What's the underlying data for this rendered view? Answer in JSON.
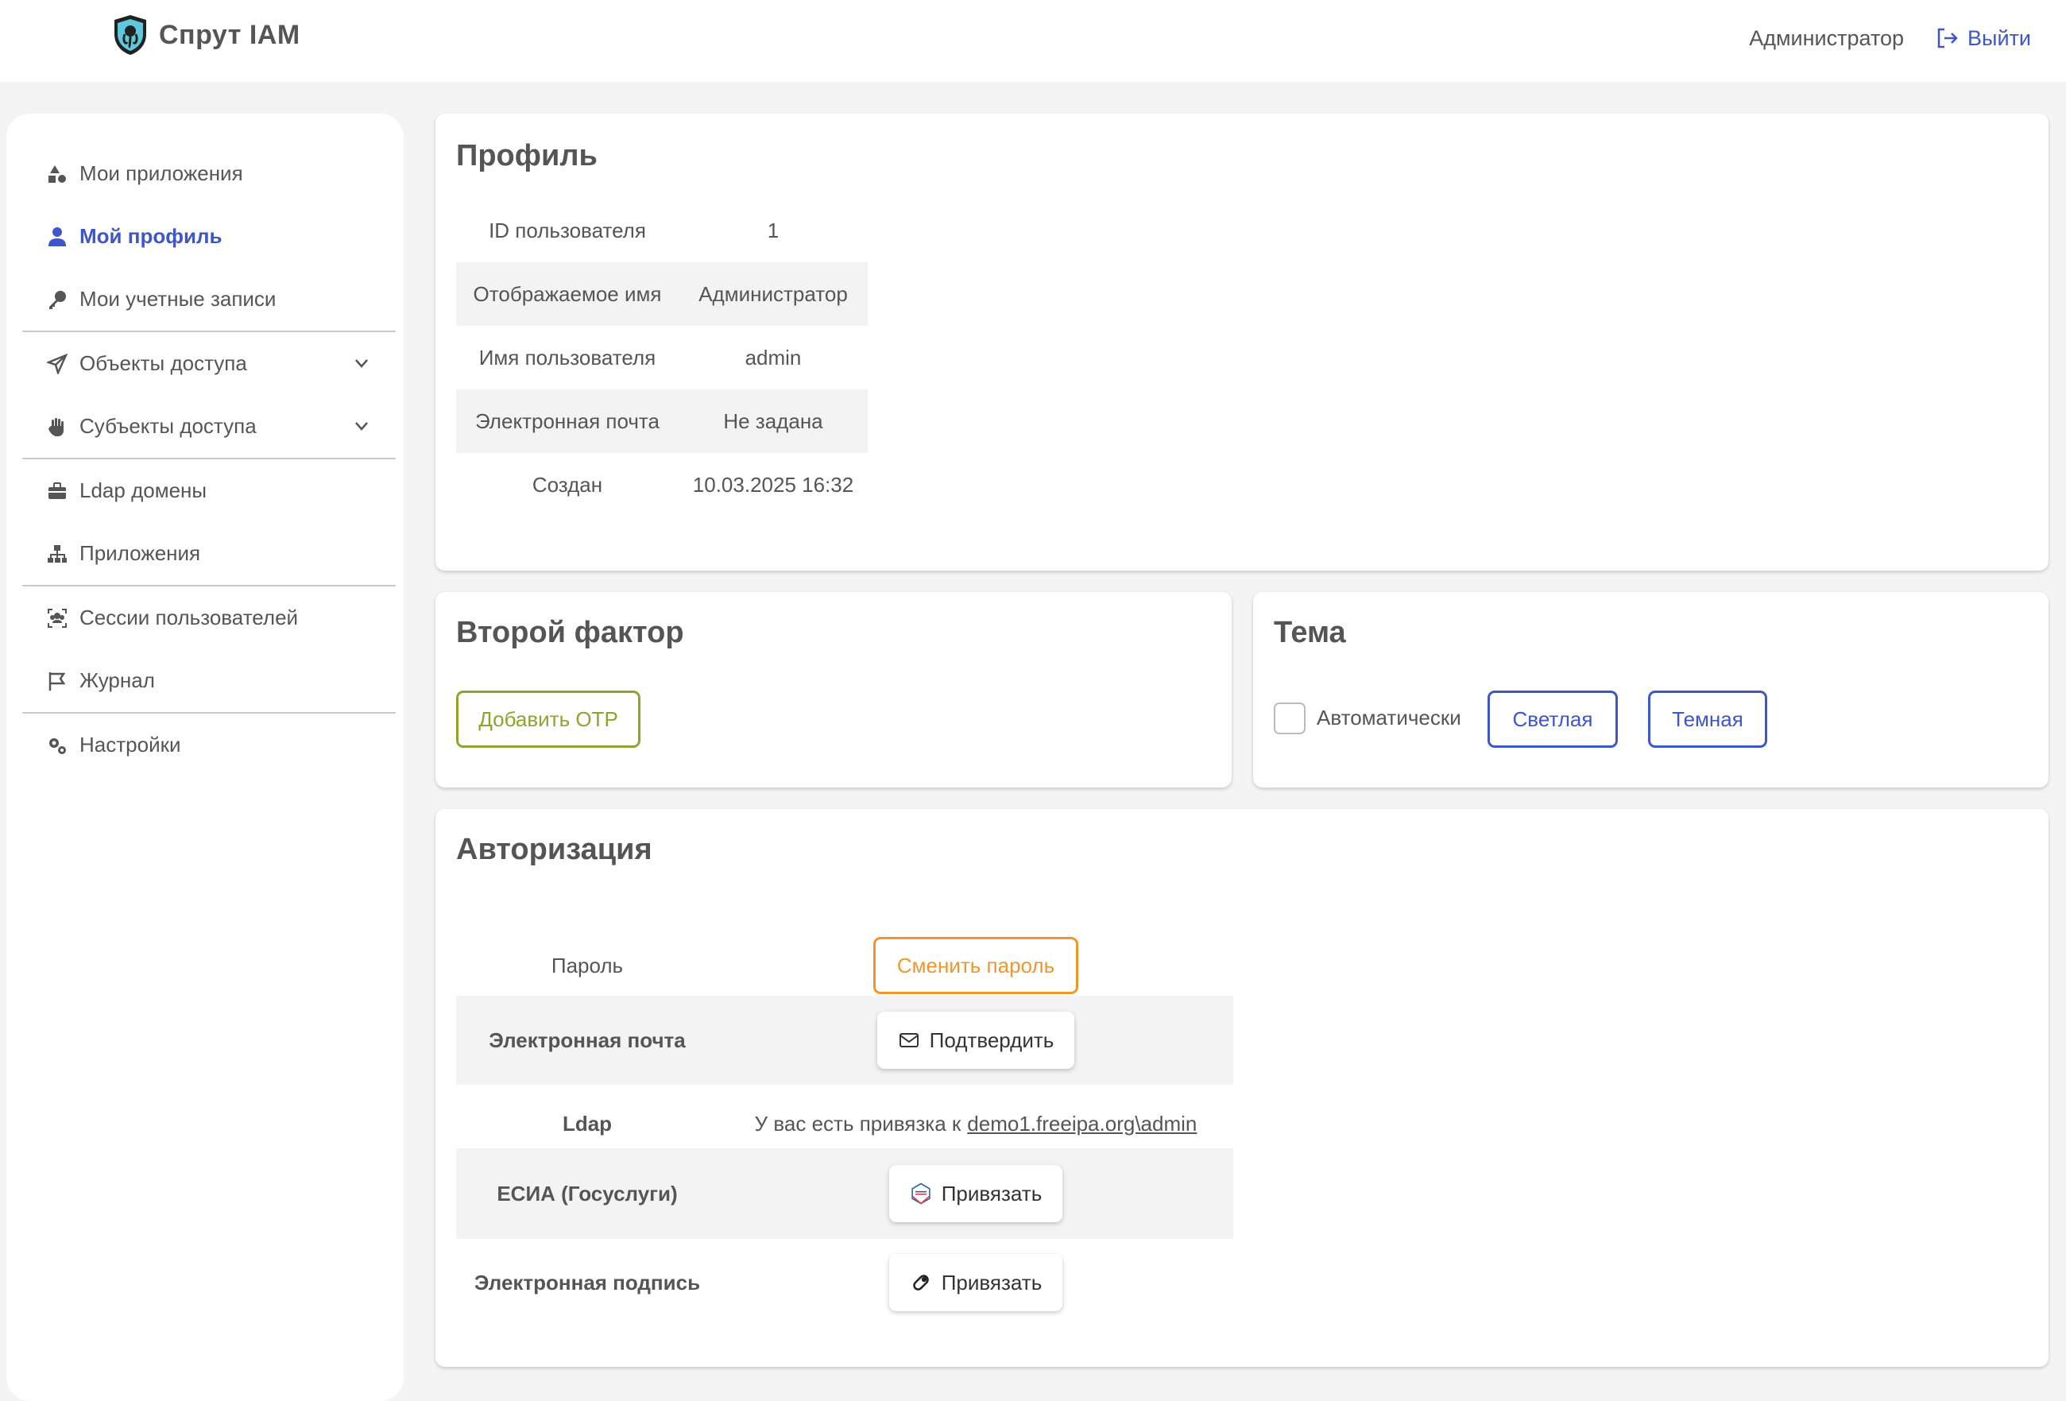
{
  "app": {
    "title": "Спрут IAM"
  },
  "header": {
    "user": "Администратор",
    "logout": "Выйти"
  },
  "sidebar": {
    "items": [
      {
        "label": "Мои приложения"
      },
      {
        "label": "Мой профиль"
      },
      {
        "label": "Мои учетные записи"
      },
      {
        "label": "Объекты доступа"
      },
      {
        "label": "Субъекты доступа"
      },
      {
        "label": "Ldap домены"
      },
      {
        "label": "Приложения"
      },
      {
        "label": "Сессии пользователей"
      },
      {
        "label": "Журнал"
      },
      {
        "label": "Настройки"
      }
    ]
  },
  "profile": {
    "title": "Профиль",
    "rows": [
      {
        "key": "ID пользователя",
        "value": "1"
      },
      {
        "key": "Отображаемое имя",
        "value": "Администратор"
      },
      {
        "key": "Имя пользователя",
        "value": "admin"
      },
      {
        "key": "Электронная почта",
        "value": "Не задана"
      },
      {
        "key": "Создан",
        "value": "10.03.2025 16:32"
      }
    ]
  },
  "second_factor": {
    "title": "Второй фактор",
    "add_otp": "Добавить OTP"
  },
  "theme": {
    "title": "Тема",
    "auto": "Автоматически",
    "light": "Светлая",
    "dark": "Темная",
    "colors": {
      "accent": "#3d56c9"
    }
  },
  "auth": {
    "title": "Авторизация",
    "password_label": "Пароль",
    "change_password": "Сменить пароль",
    "email_label": "Электронная почта",
    "confirm": "Подтвердить",
    "ldap_label": "Ldap",
    "ldap_text": "У вас есть привязка к",
    "ldap_link": "demo1.freeipa.org\\admin",
    "esia_label": "ЕСИА (Госуслуги)",
    "esia_bind": "Привязать",
    "sign_label": "Электронная подпись",
    "sign_bind": "Привязать"
  }
}
